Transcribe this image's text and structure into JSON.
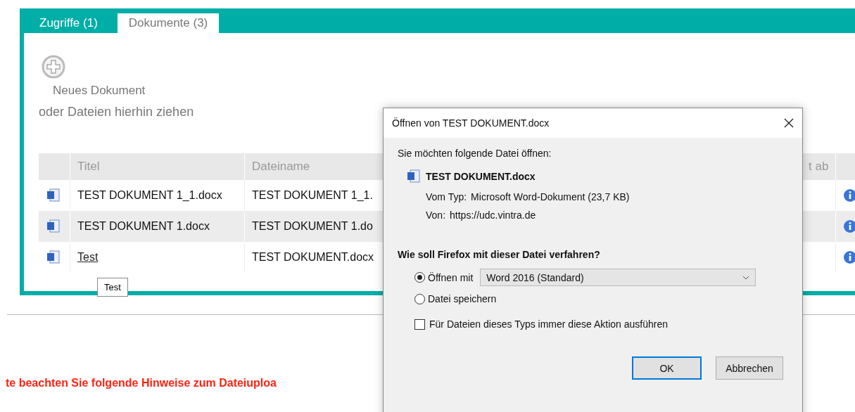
{
  "tabs": [
    {
      "label": "Zugriffe (1)",
      "selected": false
    },
    {
      "label": "Dokumente (3)",
      "selected": true
    }
  ],
  "new_document": {
    "label": "Neues Dokument",
    "hint": "oder Dateien hierhin ziehen"
  },
  "table": {
    "columns": [
      "Titel",
      "Dateiname",
      "t ab"
    ],
    "rows": [
      {
        "title": "TEST DOKUMENT 1_1.docx",
        "filename": "TEST DOKUMENT 1_1.",
        "link": false
      },
      {
        "title": "TEST DOKUMENT 1.docx",
        "filename": "TEST DOKUMENT 1.do",
        "link": false
      },
      {
        "title": "Test",
        "filename": "TEST DOKUMENT.docx",
        "link": true
      }
    ]
  },
  "tooltip": "Test",
  "notice": "te beachten Sie folgende Hinweise zum Dateiuploa",
  "dialog": {
    "title": "Öffnen von TEST DOKUMENT.docx",
    "intro": "Sie möchten folgende Datei öffnen:",
    "file_name": "TEST DOKUMENT.docx",
    "details": [
      {
        "label": "Vom Typ:",
        "value": "Microsoft Word-Dokument (23,7 KB)"
      },
      {
        "label": "Von:",
        "value": "https://udc.vintra.de"
      }
    ],
    "question": "Wie soll Firefox mit dieser Datei verfahren?",
    "options": [
      {
        "label": "Öffnen mit",
        "selected": true,
        "app": "Word 2016 (Standard)"
      },
      {
        "label": "Datei speichern",
        "selected": false
      }
    ],
    "always": {
      "label": "Für Dateien dieses Typs immer diese Aktion ausführen",
      "checked": false
    },
    "buttons": [
      {
        "label": "OK",
        "default": true
      },
      {
        "label": "Abbrechen",
        "default": false
      }
    ]
  }
}
